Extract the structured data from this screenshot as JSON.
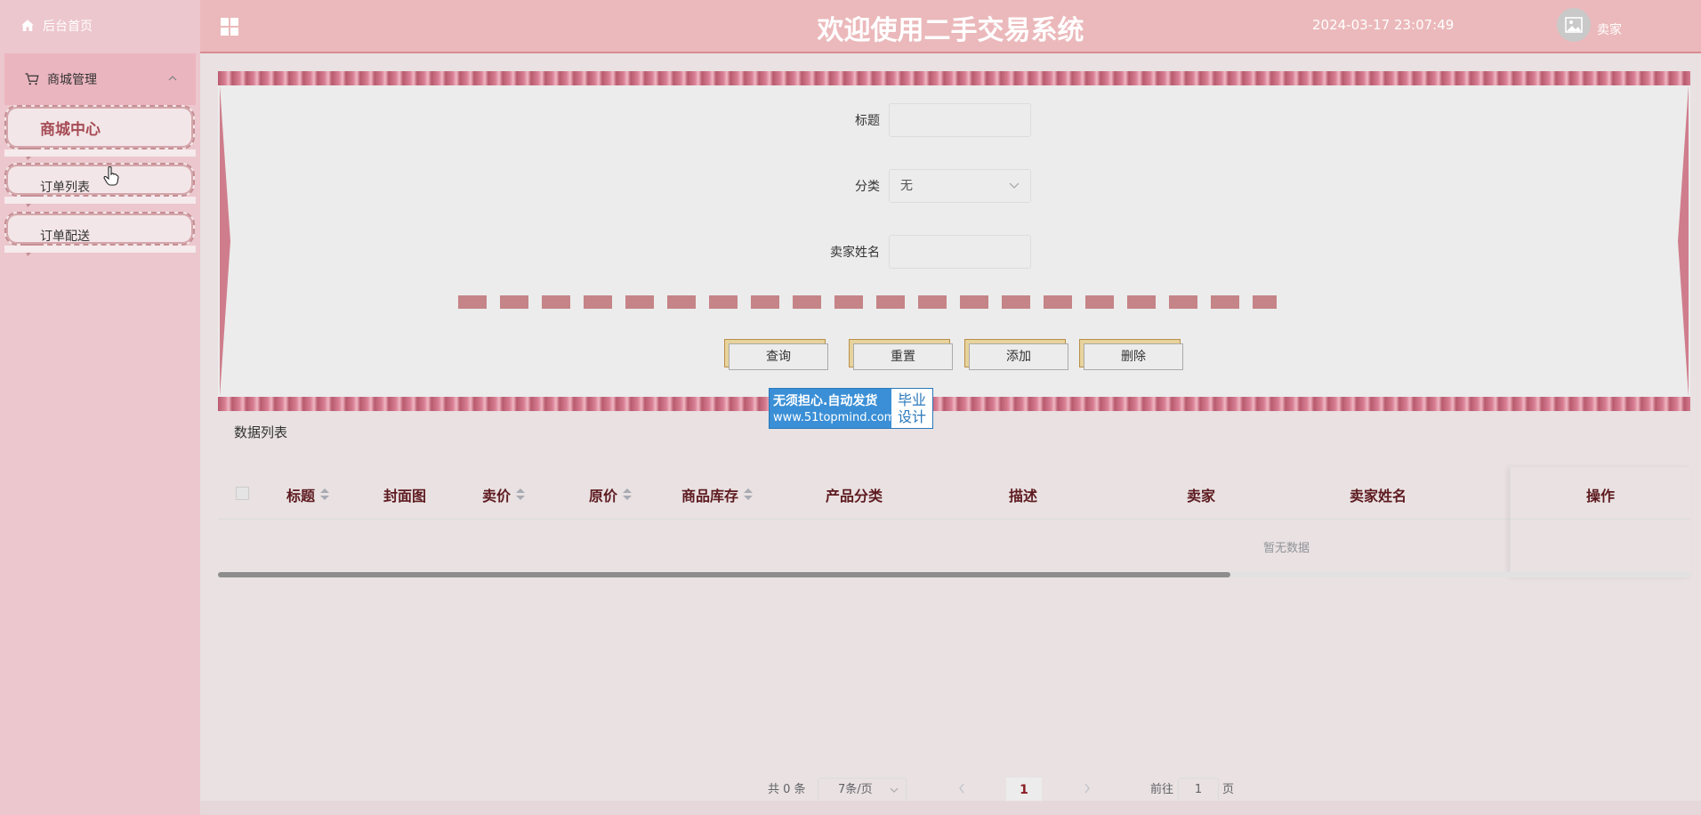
{
  "sidebar": {
    "home_label": "后台首页",
    "menu_label": "商城管理",
    "items": [
      {
        "label": "商城中心"
      },
      {
        "label": "订单列表"
      },
      {
        "label": "订单配送"
      }
    ]
  },
  "header": {
    "title": "欢迎使用二手交易系统",
    "datetime": "2024-03-17 23:07:49",
    "user": "卖家"
  },
  "search": {
    "title_label": "标题",
    "title_value": "",
    "category_label": "分类",
    "category_value": "无",
    "seller_label": "卖家姓名",
    "seller_value": "",
    "buttons": {
      "query": "查询",
      "reset": "重置",
      "add": "添加",
      "delete": "删除"
    }
  },
  "watermark": {
    "line1": "无须担心.自动发货",
    "line2": "www.51topmind.com",
    "side1": "毕业",
    "side2": "设计"
  },
  "table": {
    "title": "数据列表",
    "columns": [
      "标题",
      "封面图",
      "卖价",
      "原价",
      "商品库存",
      "产品分类",
      "描述",
      "卖家",
      "卖家姓名",
      "操作"
    ],
    "empty_text": "暂无数据"
  },
  "pagination": {
    "total": "共 0 条",
    "page_size": "7条/页",
    "current_page": "1",
    "goto_label": "前往",
    "goto_value": "1",
    "page_suffix": "页"
  },
  "colors": {
    "header_bg": "#ebb9bb",
    "sidebar_bg": "#ecc7cd",
    "accent": "#c58487",
    "table_header_text": "#5d1a1f"
  }
}
